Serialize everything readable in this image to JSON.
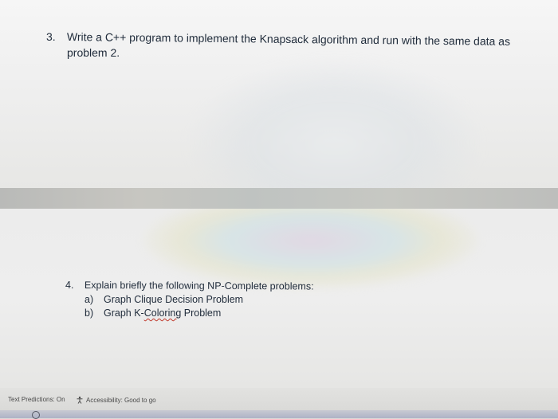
{
  "question3": {
    "number": "3.",
    "line1": "Write a C++ program to implement the Knapsack algorithm and run with the same data as",
    "line2": "problem 2."
  },
  "question4": {
    "number": "4.",
    "text": "Explain briefly the following NP-Complete problems:",
    "items": [
      {
        "label": "a)",
        "text": "Graph Clique Decision Problem"
      },
      {
        "label": "b)",
        "text_before": "Graph K-",
        "text_flagged": "Coloring",
        "text_after": " Problem"
      }
    ]
  },
  "status_bar": {
    "text_predictions": "Text Predictions: On",
    "accessibility": "Accessibility: Good to go",
    "accessibility_icon": "accessibility-icon"
  },
  "taskbar": {
    "search_icon": "search-icon"
  },
  "colors": {
    "text": "#1f2b3a",
    "spell_underline": "#c0392b"
  }
}
